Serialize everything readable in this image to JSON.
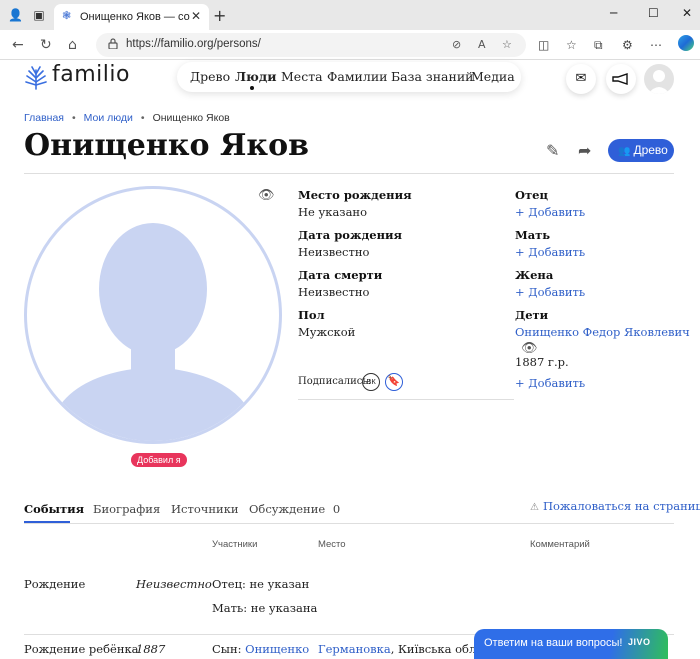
{
  "browser": {
    "tab_title": "Онищенко Яков — сохранить п",
    "url": "https://familio.org/persons/",
    "new_tab_symbol": "+",
    "close_symbol": "✕"
  },
  "site": {
    "logo_text": "familio",
    "nav": [
      "Древо",
      "Люди",
      "Места",
      "Фамилии",
      "База знаний",
      "Медиа"
    ],
    "active_nav": "Люди"
  },
  "breadcrumbs": [
    "Главная",
    "Мои люди",
    "Онищенко Яков"
  ],
  "person": {
    "name": "Онищенко Яков",
    "tree_button": "Древо",
    "added_badge": "Добавил я"
  },
  "fields": {
    "birth_place_label": "Место рождения",
    "birth_place_value": "Не указано",
    "birth_date_label": "Дата рождения",
    "birth_date_value": "Неизвестно",
    "death_date_label": "Дата смерти",
    "death_date_value": "Неизвестно",
    "gender_label": "Пол",
    "gender_value": "Мужской"
  },
  "relatives": {
    "father_label": "Отец",
    "mother_label": "Мать",
    "wife_label": "Жена",
    "children_label": "Дети",
    "add_label": "+ Добавить",
    "child_name": "Онищенко Федор Яковлевич",
    "child_year": "1887 г.р."
  },
  "subscribers": {
    "label": "Подписались:",
    "vk": "ВК"
  },
  "tabs": {
    "events": "События",
    "biography": "Биография",
    "sources": "Источники",
    "discussion": "Обсуждение",
    "discussion_count": "0",
    "complain": "Пожаловаться на страницу"
  },
  "events_table": {
    "headers": {
      "participants": "Участники",
      "place": "Место",
      "comment": "Комментарий"
    },
    "rows": [
      {
        "event": "Рождение",
        "date": "Неизвестно",
        "participants": [
          "Отец: не указан",
          "Мать: не указана"
        ]
      },
      {
        "event": "Рождение ребёнка",
        "date": "1887",
        "participant_prefix": "Сын:",
        "participant_link": "Онищенко",
        "place_link": "Германовка",
        "place_rest": ", Київська область"
      }
    ]
  },
  "chat": {
    "message": "Ответим на ваши вопросы!",
    "brand": "JIVO"
  },
  "colors": {
    "accent": "#2f5fd8",
    "link": "#2f5fc8",
    "badge": "#e8355c",
    "silhouette": "#c9d4f2"
  }
}
